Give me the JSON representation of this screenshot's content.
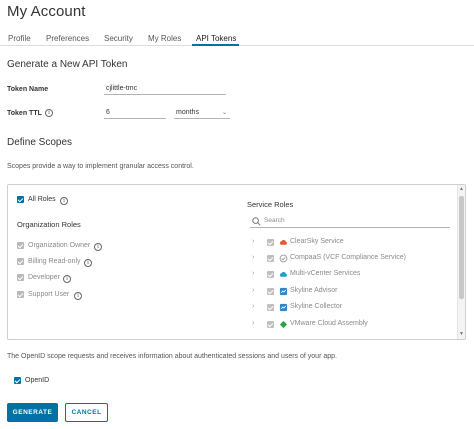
{
  "page": {
    "title": "My Account"
  },
  "tabs": [
    {
      "label": "Profile"
    },
    {
      "label": "Preferences"
    },
    {
      "label": "Security"
    },
    {
      "label": "My Roles"
    },
    {
      "label": "API Tokens"
    }
  ],
  "active_tab": "API Tokens",
  "form": {
    "heading": "Generate a New API Token",
    "token_name_label": "Token Name",
    "token_name_value": "cjlittle-tmc",
    "token_ttl_label": "Token TTL",
    "token_ttl_value": "6",
    "ttl_unit": "months",
    "info_glyph": "i"
  },
  "scopes": {
    "heading": "Define Scopes",
    "description": "Scopes provide a way to implement granular access control.",
    "all_roles_label": "All Roles",
    "org_roles_heading": "Organization Roles",
    "org_roles": [
      {
        "label": "Organization Owner"
      },
      {
        "label": "Billing Read-only"
      },
      {
        "label": "Developer"
      },
      {
        "label": "Support User"
      }
    ],
    "service_roles_heading": "Service Roles",
    "search_placeholder": "Search",
    "services": [
      {
        "label": "ClearSky Service",
        "icon": "cloud-icon",
        "color": "#e05a32"
      },
      {
        "label": "CompaaS (VCF Compliance Service)",
        "icon": "compliance-icon",
        "color": "#9a9a9a"
      },
      {
        "label": "Multi-vCenter Services",
        "icon": "cloud-icon",
        "color": "#1fa0c8"
      },
      {
        "label": "Skyline Advisor",
        "icon": "skyline-icon",
        "color": "#2f86c8"
      },
      {
        "label": "Skyline Collector",
        "icon": "skyline-icon",
        "color": "#2f86c8"
      },
      {
        "label": "VMware Cloud Assembly",
        "icon": "assembly-icon",
        "color": "#2aa64a"
      }
    ]
  },
  "openid": {
    "description": "The OpenID scope requests and receives information about authenticated sessions and users of your app.",
    "label": "OpenID"
  },
  "actions": {
    "generate_label": "GENERATE",
    "cancel_label": "CANCEL"
  },
  "colors": {
    "accent": "#0072a3"
  }
}
